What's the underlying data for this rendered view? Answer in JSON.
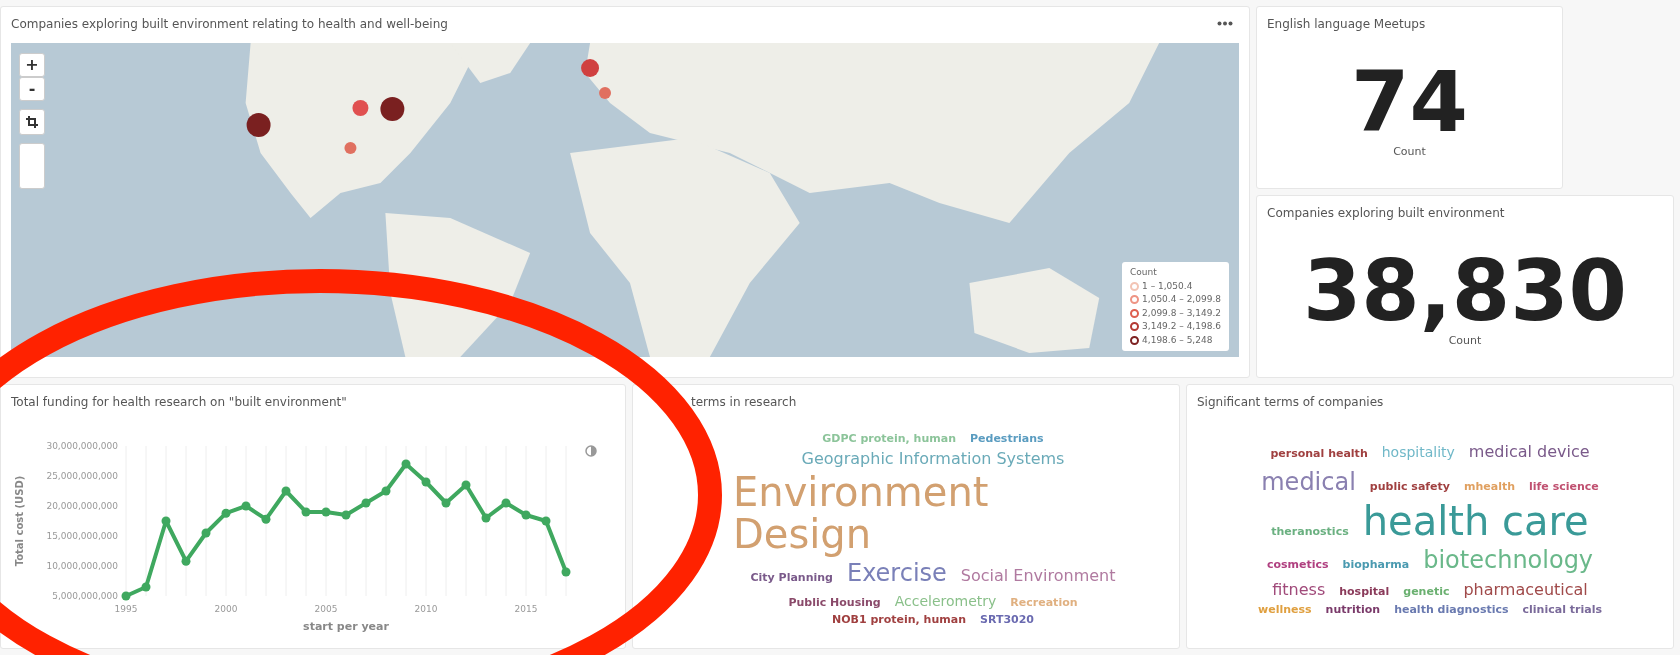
{
  "map_panel": {
    "title": "Companies exploring built environment relating to health and well-being",
    "zoom_in": "+",
    "zoom_out": "-",
    "legend": {
      "title": "Count",
      "ranges": [
        {
          "label": "1 – 1,050.4",
          "color": "#f3c4b4"
        },
        {
          "label": "1,050.4 – 2,099.8",
          "color": "#ee9484"
        },
        {
          "label": "2,099.8 – 3,149.2",
          "color": "#de6050"
        },
        {
          "label": "3,149.2 – 4,198.6",
          "color": "#b43a34"
        },
        {
          "label": "4,198.6 – 5,248",
          "color": "#7e2222"
        }
      ]
    }
  },
  "metrics": [
    {
      "title": "English language Meetups",
      "value": "74",
      "label": "Count"
    },
    {
      "title": "Companies exploring built environment",
      "value": "38,830",
      "label": "Count"
    }
  ],
  "funding_panel": {
    "title": "Total funding for health research on \"built environment\"",
    "chart_data": {
      "type": "line",
      "xlabel": "start per year",
      "ylabel": "Total cost (USD)",
      "grid": true,
      "x": [
        1995,
        1996,
        1997,
        1998,
        1999,
        2000,
        2001,
        2002,
        2003,
        2004,
        2005,
        2006,
        2007,
        2008,
        2009,
        2010,
        2011,
        2012,
        2013,
        2014,
        2015,
        2016,
        2017
      ],
      "series": [
        {
          "color": "#3fa85f",
          "marker": "circle",
          "values": [
            5000000000,
            6500000000,
            17500000000,
            10800000000,
            15500000000,
            18800000000,
            20000000000,
            17800000000,
            22500000000,
            19000000000,
            19000000000,
            18500000000,
            20500000000,
            22500000000,
            27000000000,
            24000000000,
            20500000000,
            23500000000,
            18000000000,
            20500000000,
            18500000000,
            17500000000,
            9000000000
          ]
        }
      ],
      "xlim": [
        1995,
        2017
      ],
      "ylim": [
        5000000000,
        30000000000
      ],
      "xticks": [
        1995,
        2000,
        2005,
        2010,
        2015
      ],
      "yticks": [
        {
          "value": 5000000000,
          "label": "5,000,000,000"
        },
        {
          "value": 10000000000,
          "label": "10,000,000,000"
        },
        {
          "value": 15000000000,
          "label": "15,000,000,000"
        },
        {
          "value": 20000000000,
          "label": "20,000,000,000"
        },
        {
          "value": 25000000000,
          "label": "25,000,000,000"
        },
        {
          "value": 30000000000,
          "label": "30,000,000,000"
        }
      ]
    }
  },
  "research_terms": {
    "title": "terms in research",
    "words": [
      {
        "text": "GDPC protein, human",
        "kind": "tiny",
        "color": "#8cc49a"
      },
      {
        "text": "Pedestrians",
        "kind": "tiny",
        "color": "#5a9cc0"
      },
      {
        "text": "Geographic Information Systems",
        "kind": "medium",
        "color": "#6aaab8"
      },
      {
        "text": "Environment Design",
        "kind": "huge",
        "color": "#d2a070"
      },
      {
        "text": "City Planning",
        "kind": "tiny",
        "color": "#7a5a8a"
      },
      {
        "text": "Exercise",
        "kind": "large",
        "color": "#7a80b8"
      },
      {
        "text": "Social Environment",
        "kind": "medium",
        "color": "#b07aa0"
      },
      {
        "text": "Public Housing",
        "kind": "tiny",
        "color": "#8a4a6a"
      },
      {
        "text": "Accelerometry",
        "kind": "small",
        "color": "#8ac08a"
      },
      {
        "text": "Recreation",
        "kind": "tiny",
        "color": "#e0b080"
      },
      {
        "text": "NOB1 protein, human",
        "kind": "tiny",
        "color": "#a04040"
      },
      {
        "text": "SRT3020",
        "kind": "tiny",
        "color": "#6a6ab0"
      }
    ]
  },
  "company_terms": {
    "title": "Significant terms of companies",
    "words": [
      {
        "text": "personal health",
        "kind": "tiny",
        "color": "#a04040"
      },
      {
        "text": "hospitality",
        "kind": "small",
        "color": "#70b8c8"
      },
      {
        "text": "medical device",
        "kind": "medium",
        "color": "#7a5a8a"
      },
      {
        "text": "medical",
        "kind": "large",
        "color": "#8a80b0"
      },
      {
        "text": "public safety",
        "kind": "tiny",
        "color": "#a04040"
      },
      {
        "text": "mhealth",
        "kind": "tiny",
        "color": "#e0a060"
      },
      {
        "text": "life science",
        "kind": "tiny",
        "color": "#c05070"
      },
      {
        "text": "theranostics",
        "kind": "tiny",
        "color": "#6ab080"
      },
      {
        "text": "health care",
        "kind": "huge",
        "color": "#3a9a98"
      },
      {
        "text": "cosmetics",
        "kind": "tiny",
        "color": "#b04080"
      },
      {
        "text": "biopharma",
        "kind": "tiny",
        "color": "#4a9ab0"
      },
      {
        "text": "biotechnology",
        "kind": "large",
        "color": "#6ab88a"
      },
      {
        "text": "fitness",
        "kind": "medium",
        "color": "#a04a7a"
      },
      {
        "text": "hospital",
        "kind": "tiny",
        "color": "#8a3a5a"
      },
      {
        "text": "genetic",
        "kind": "tiny",
        "color": "#6ab070"
      },
      {
        "text": "pharmaceutical",
        "kind": "medium",
        "color": "#a04a4a"
      },
      {
        "text": "wellness",
        "kind": "tiny",
        "color": "#e0a040"
      },
      {
        "text": "nutrition",
        "kind": "tiny",
        "color": "#7a3a6a"
      },
      {
        "text": "health diagnostics",
        "kind": "tiny",
        "color": "#6a7ab0"
      },
      {
        "text": "clinical trials",
        "kind": "tiny",
        "color": "#7a6a9a"
      }
    ]
  }
}
